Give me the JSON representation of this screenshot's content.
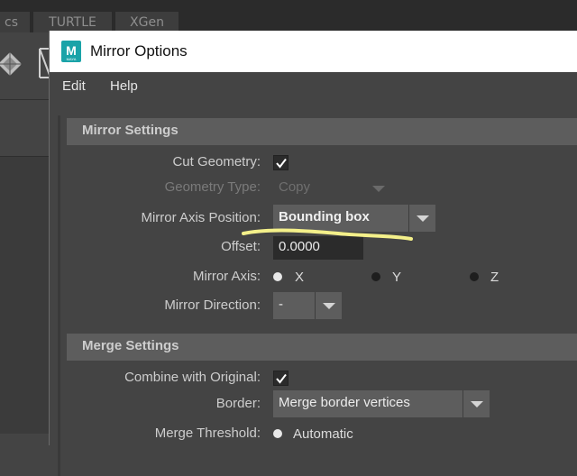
{
  "background": {
    "tabs": [
      "cs",
      "TURTLE",
      "XGen"
    ]
  },
  "dialog": {
    "title": "Mirror Options",
    "logo_letter": "M",
    "menu": [
      "Edit",
      "Help"
    ],
    "mirror_settings": {
      "header": "Mirror Settings",
      "cut_geometry_label": "Cut Geometry:",
      "cut_geometry_checked": true,
      "geometry_type_label": "Geometry Type:",
      "geometry_type_value": "Copy",
      "mirror_axis_position_label": "Mirror Axis Position:",
      "mirror_axis_position_value": "Bounding box",
      "offset_label": "Offset:",
      "offset_value": "0.0000",
      "mirror_axis_label": "Mirror Axis:",
      "axes": [
        {
          "label": "X",
          "selected": true
        },
        {
          "label": "Y",
          "selected": false
        },
        {
          "label": "Z",
          "selected": false
        }
      ],
      "mirror_direction_label": "Mirror Direction:",
      "mirror_direction_value": "-"
    },
    "merge_settings": {
      "header": "Merge Settings",
      "combine_label": "Combine with Original:",
      "combine_checked": true,
      "border_label": "Border:",
      "border_value": "Merge border vertices",
      "merge_threshold_label": "Merge Threshold:",
      "merge_threshold_value": "Automatic"
    }
  },
  "colors": {
    "highlight_stroke": "#f4f08a",
    "dialog_bg": "#444444",
    "section_header_bg": "#5d5d5d"
  }
}
